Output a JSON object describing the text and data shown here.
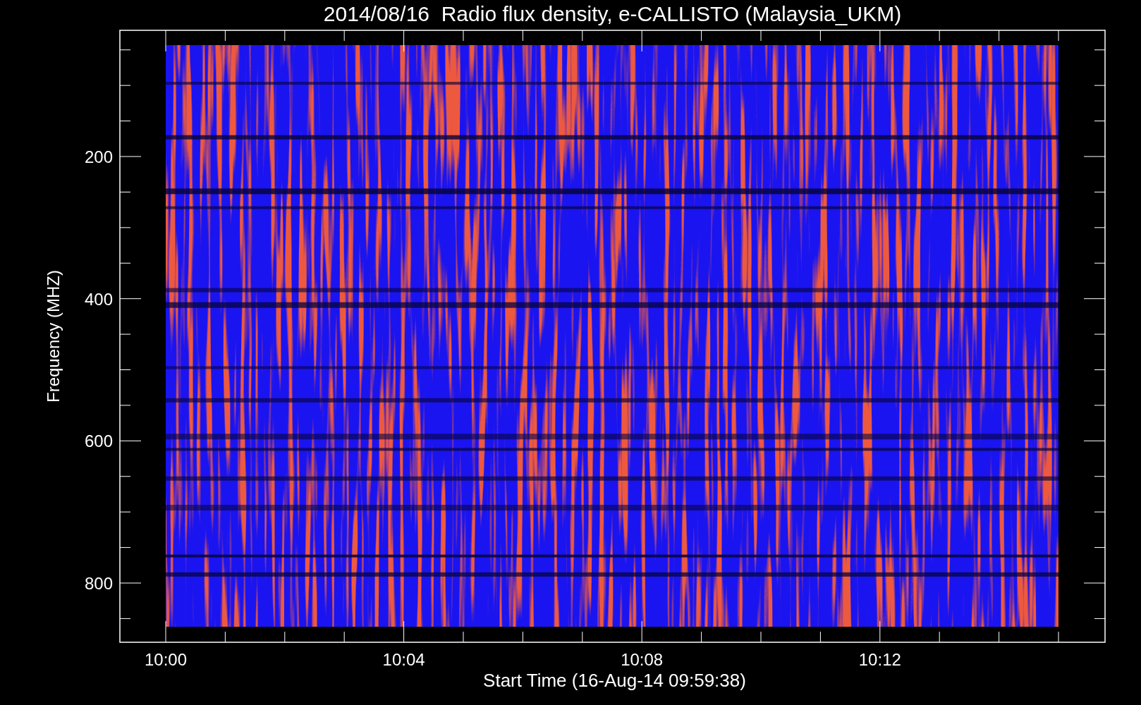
{
  "title": "2014/08/16  Radio flux density, e-CALLISTO (Malaysia_UKM)",
  "y_axis": {
    "label": "Frequency (MHZ)",
    "ticks": [
      "200",
      "400",
      "600",
      "800"
    ]
  },
  "x_axis": {
    "label": "Start Time (16-Aug-14 09:59:38)",
    "ticks": [
      "10:00",
      "10:04",
      "10:08",
      "10:12"
    ]
  }
}
